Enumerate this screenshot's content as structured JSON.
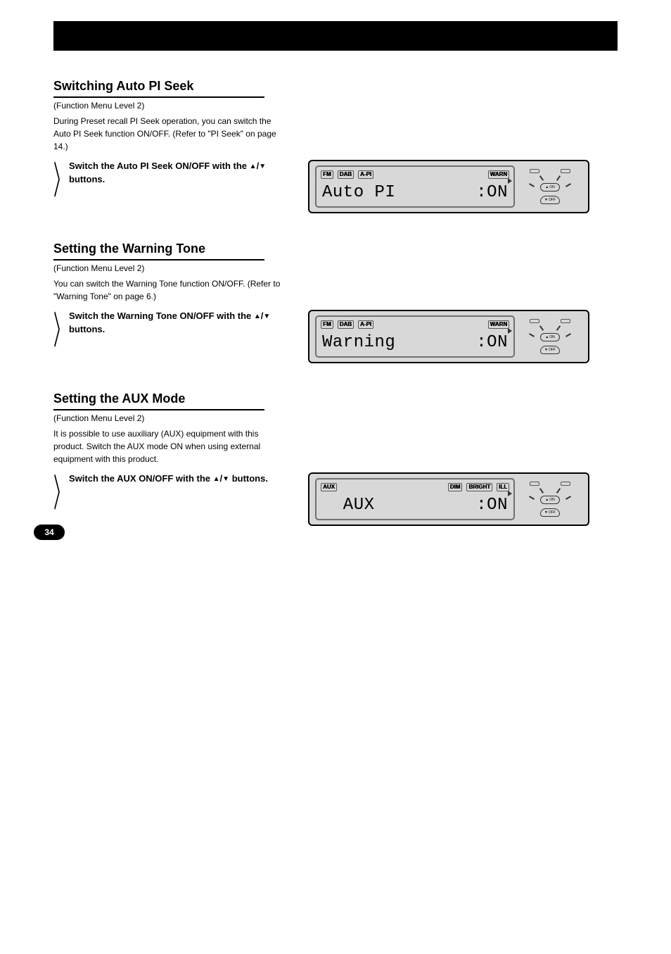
{
  "page": {
    "number": "34"
  },
  "sections": [
    {
      "title": "Switching Auto PI Seek",
      "level_label": "(Function Menu Level 2)",
      "description": "During Preset recall PI Seek operation, you can switch the Auto PI Seek function ON/OFF. (Refer to \"PI Seek\" on page 14.)",
      "instruction": "Switch the Auto PI Seek ON/OFF with the ▲/▼ buttons.",
      "lcd": {
        "tags": [
          {
            "text": "FM",
            "on": true
          },
          {
            "text": "DAB",
            "on": true
          },
          {
            "text": "A-PI",
            "on": true
          },
          {
            "spacer": true
          },
          {
            "text": "WARN",
            "on": true
          }
        ],
        "main_left": "Auto PI",
        "main_right": ":ON"
      }
    },
    {
      "title": "Setting the Warning Tone",
      "level_label": "(Function Menu Level 2)",
      "description": "You can switch the Warning Tone function ON/OFF. (Refer to \"Warning Tone\" on page 6.)",
      "instruction": "Switch the Warning Tone ON/OFF with the ▲/▼ buttons.",
      "lcd": {
        "tags": [
          {
            "text": "FM",
            "on": true
          },
          {
            "text": "DAB",
            "on": true
          },
          {
            "text": "A-PI",
            "on": true
          },
          {
            "spacer": true
          },
          {
            "text": "WARN",
            "on": true
          }
        ],
        "main_left": "Warning",
        "main_right": ":ON"
      }
    },
    {
      "title": "Setting the AUX Mode",
      "level_label": "(Function Menu Level 2)",
      "description": "It is possible to use auxiliary (AUX) equipment with this product. Switch the AUX mode ON when using external equipment with this product.",
      "instruction": "Switch the AUX ON/OFF with the ▲/▼ buttons.",
      "lcd": {
        "tags": [
          {
            "text": "AUX",
            "on": true
          },
          {
            "spacer": true
          },
          {
            "text": "DIM",
            "on": true
          },
          {
            "text": "BRIGHT",
            "on": true
          },
          {
            "text": "ILL",
            "on": true
          }
        ],
        "main_left": "  AUX",
        "main_right": ":ON"
      }
    }
  ],
  "knob": {
    "on_label": "ON",
    "off_label": "OFF"
  }
}
